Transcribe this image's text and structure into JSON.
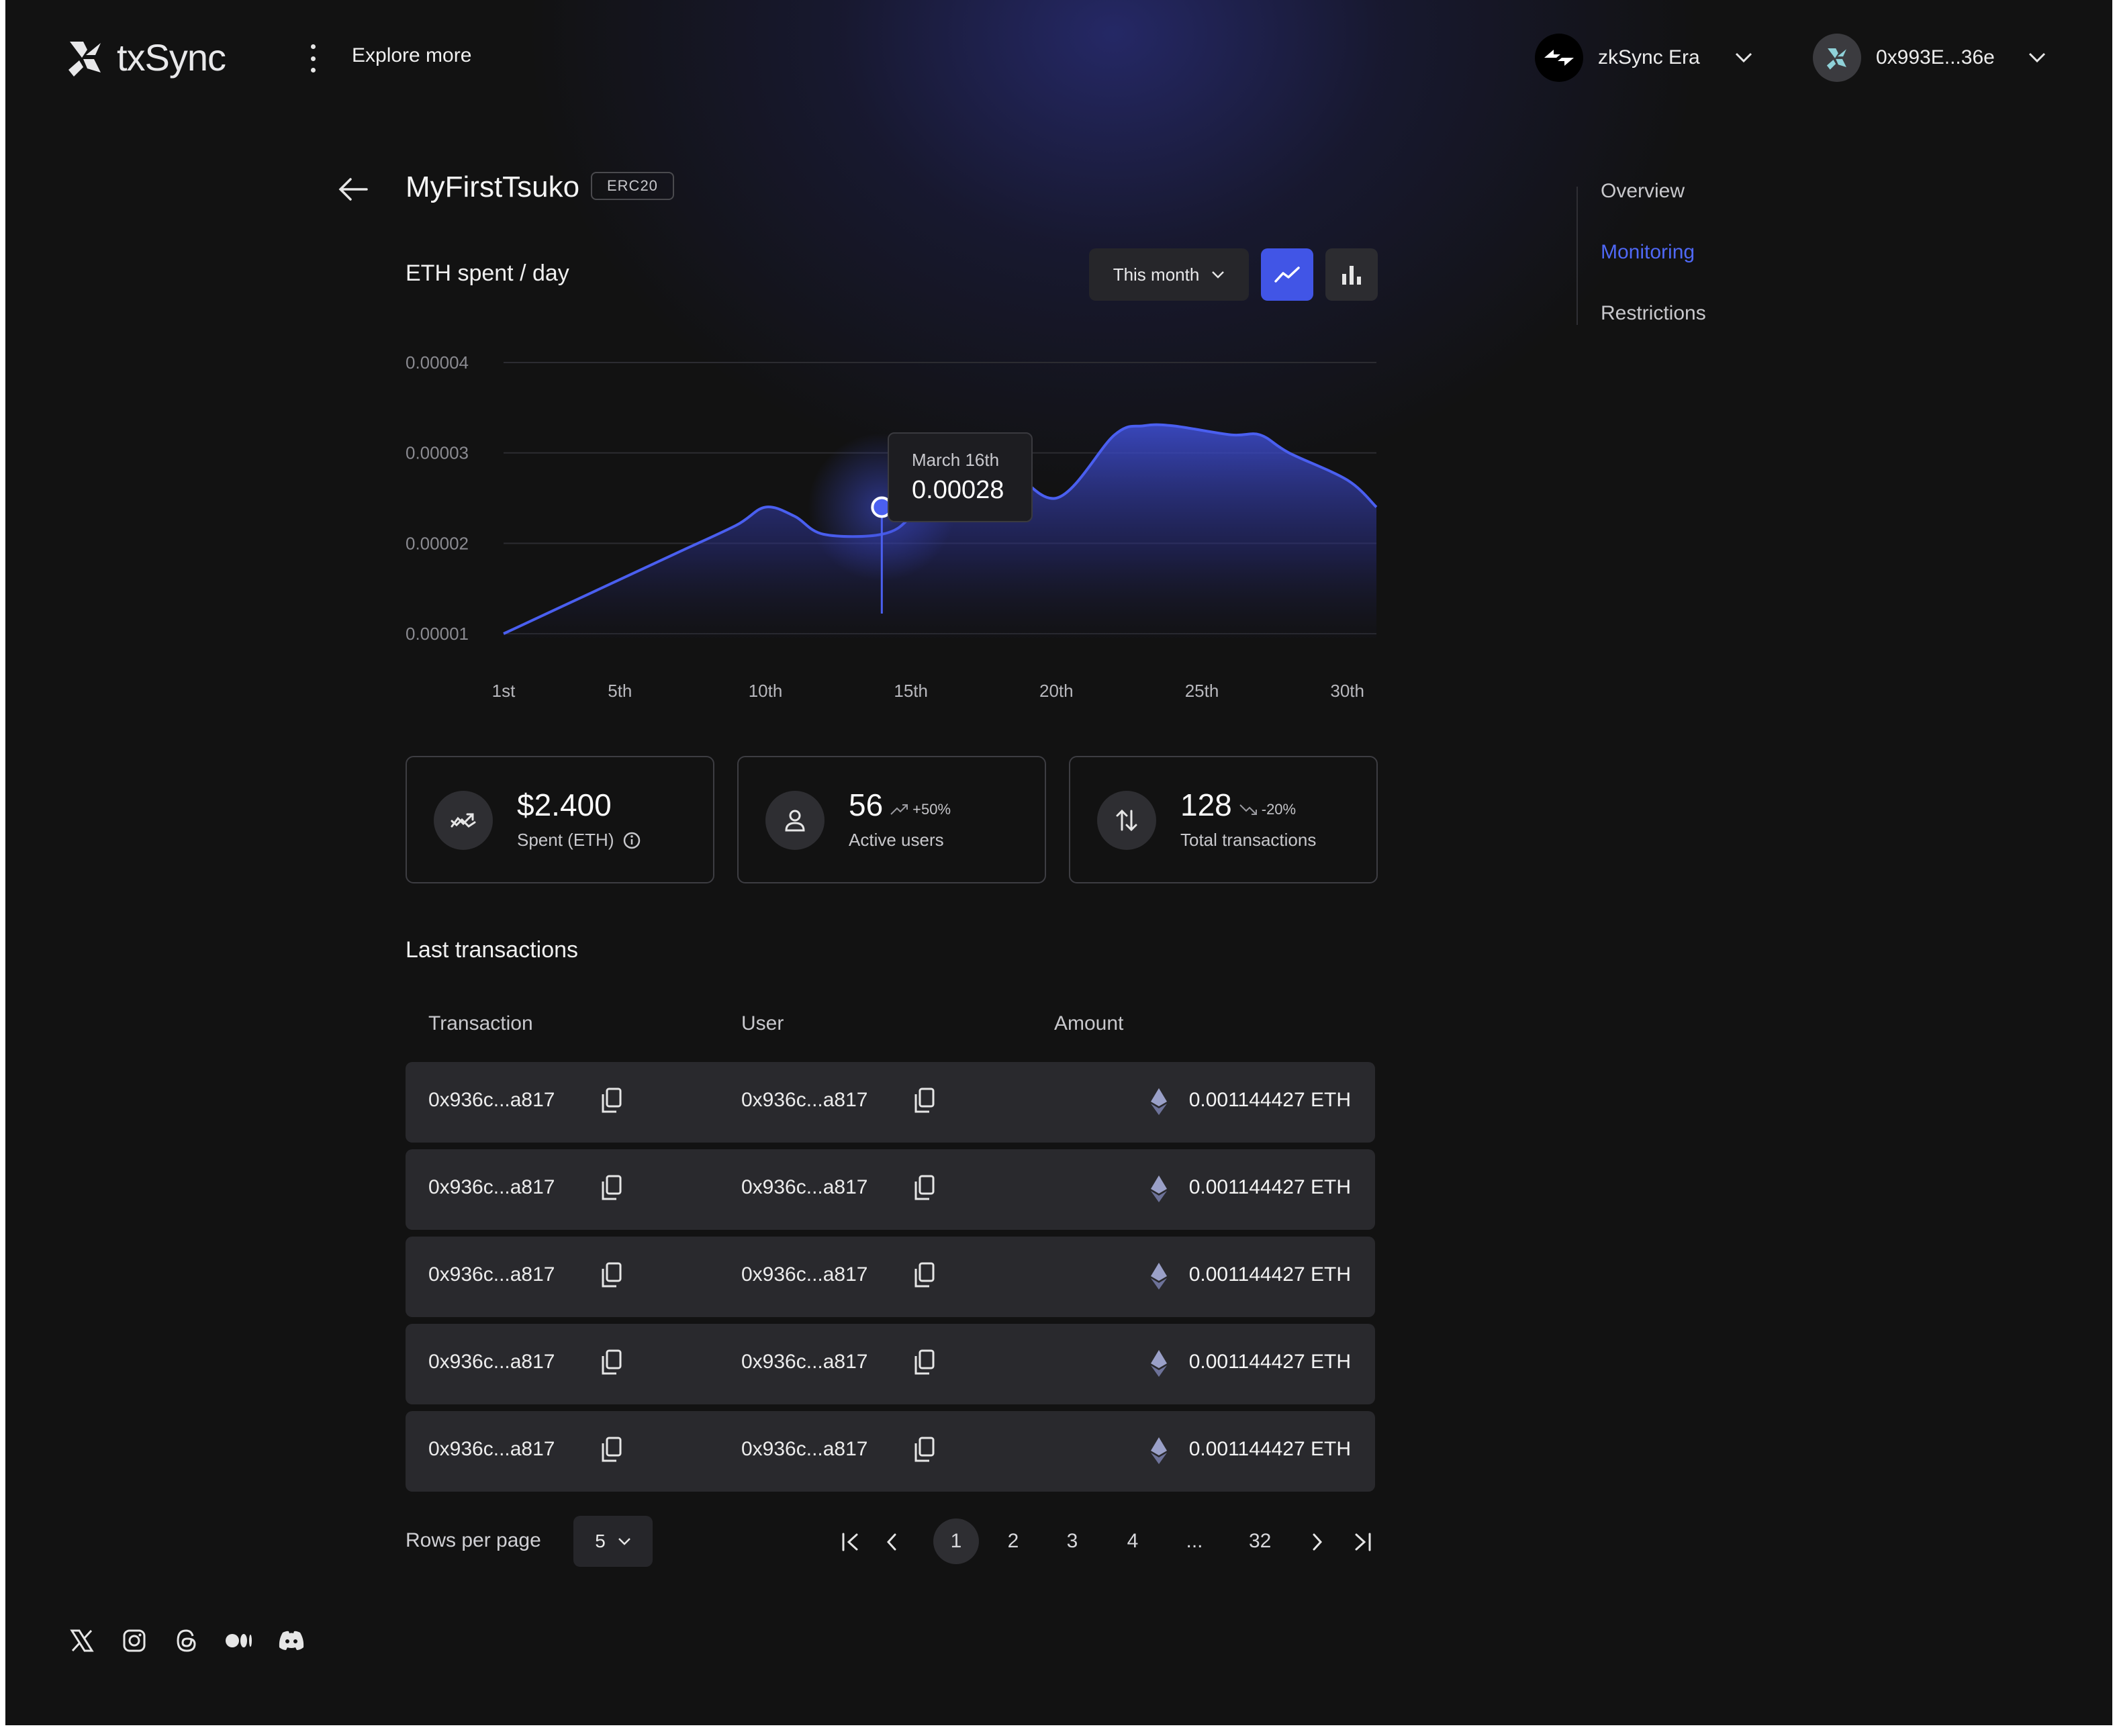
{
  "header": {
    "brand": "txSync",
    "explore_label": "Explore more",
    "network": "zkSync Era",
    "wallet": "0x993E...36e"
  },
  "page": {
    "title": "MyFirstTsuko",
    "badge": "ERC20"
  },
  "chart_header": {
    "title": "ETH spent / day",
    "range_label": "This month",
    "active_type": "line"
  },
  "chart_data": {
    "type": "area",
    "title": "ETH spent / day",
    "xlabel": "",
    "ylabel": "",
    "x": [
      1,
      3,
      5,
      7,
      9,
      10,
      11,
      12,
      14,
      15,
      16,
      18,
      20,
      22,
      23,
      24,
      26,
      27,
      28,
      30,
      31
    ],
    "y": [
      1e-05,
      1.3e-05,
      1.6e-05,
      1.9e-05,
      2.2e-05,
      2.4e-05,
      2.3e-05,
      2.1e-05,
      2.1e-05,
      2.3e-05,
      2.8e-05,
      2.9e-05,
      2.5e-05,
      3.2e-05,
      3.3e-05,
      3.3e-05,
      3.2e-05,
      3.2e-05,
      3e-05,
      2.7e-05,
      2.4e-05
    ],
    "xticks": [
      "1st",
      "5th",
      "10th",
      "15th",
      "20th",
      "25th",
      "30th"
    ],
    "xtick_values": [
      1,
      5,
      10,
      15,
      20,
      25,
      30
    ],
    "yticks": [
      "0.00001",
      "0.00002",
      "0.00003",
      "0.00004"
    ],
    "ytick_values": [
      1e-05,
      2e-05,
      3e-05,
      4e-05
    ],
    "ylim": [
      1e-05,
      4e-05
    ],
    "xlim": [
      1,
      31
    ],
    "grid": true,
    "color": "#4a5ff0",
    "highlight": {
      "x": 14,
      "y": 2.4e-05,
      "date_label": "March 16th",
      "value_label": "0.00028"
    }
  },
  "stats": [
    {
      "value": "$2.400",
      "label": "Spent (ETH)",
      "icon": "trend-icon"
    },
    {
      "value": "56",
      "delta": "+50%",
      "label": "Active users",
      "icon": "user-icon"
    },
    {
      "value": "128",
      "delta": "-20%",
      "label": "Total transactions",
      "icon": "arrows-icon"
    }
  ],
  "transactions": {
    "title": "Last transactions",
    "columns": [
      "Transaction",
      "User",
      "Amount"
    ],
    "rows": [
      {
        "tx": "0x936c...a817",
        "user": "0x936c...a817",
        "amount": "0.001144427 ETH"
      },
      {
        "tx": "0x936c...a817",
        "user": "0x936c...a817",
        "amount": "0.001144427 ETH"
      },
      {
        "tx": "0x936c...a817",
        "user": "0x936c...a817",
        "amount": "0.001144427 ETH"
      },
      {
        "tx": "0x936c...a817",
        "user": "0x936c...a817",
        "amount": "0.001144427 ETH"
      },
      {
        "tx": "0x936c...a817",
        "user": "0x936c...a817",
        "amount": "0.001144427 ETH"
      }
    ]
  },
  "pagination": {
    "rows_label": "Rows per page",
    "rows_value": "5",
    "pages": [
      "1",
      "2",
      "3",
      "4",
      "...",
      "32"
    ],
    "current": "1"
  },
  "side_nav": {
    "items": [
      "Overview",
      "Monitoring",
      "Restrictions"
    ],
    "active": "Monitoring"
  },
  "socials": [
    "x-icon",
    "instagram-icon",
    "threads-icon",
    "medium-icon",
    "discord-icon"
  ],
  "colors": {
    "accent": "#4155e6",
    "background": "#121212"
  }
}
